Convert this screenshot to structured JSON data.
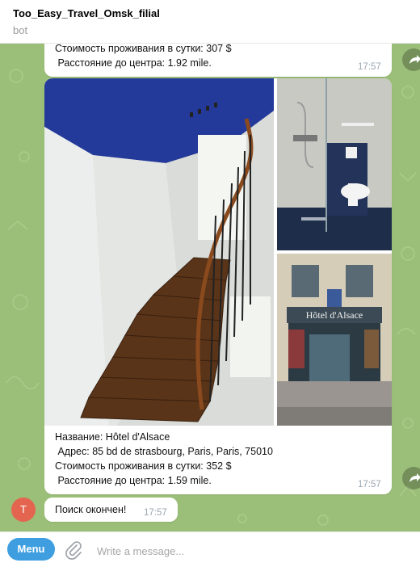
{
  "header": {
    "title": "Too_Easy_Travel_Omsk_filial",
    "subtitle": "bot"
  },
  "messages": [
    {
      "lines": [
        "Стоимость проживания в сутки: 307 $",
        " Расстояние до центра: 1.92 mile."
      ],
      "time": "17:57"
    },
    {
      "photos": [
        "staircase-photo",
        "bathroom-photo",
        "hotel-facade-photo"
      ],
      "sign_text": "Hôtel d'Alsace",
      "lines": [
        "Название: Hôtel d'Alsace",
        " Адрес: 85 bd de strasbourg, Paris, Paris, 75010",
        "Стоимость проживания в сутки: 352 $",
        " Расстояние до центра: 1.59 mile."
      ],
      "time": "17:57"
    },
    {
      "avatar_letter": "T",
      "text": "Поиск окончен!",
      "time": "17:57"
    }
  ],
  "composer": {
    "menu_label": "Menu",
    "placeholder": "Write a message..."
  },
  "colors": {
    "chat_background": "#9bbf79",
    "menu_button": "#3e9ee0",
    "avatar": "#e4654f"
  }
}
